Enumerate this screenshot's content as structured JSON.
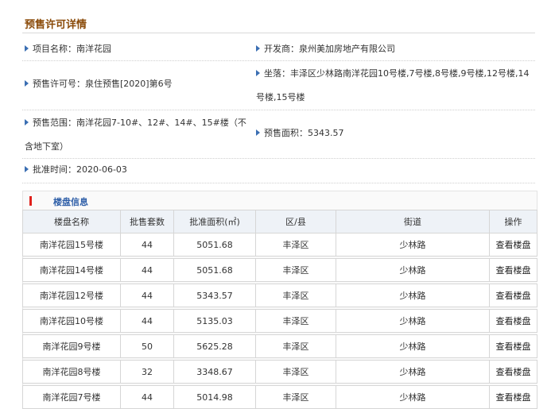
{
  "page_title": "预售许可详情",
  "details": {
    "project_name": "项目名称：南洋花园",
    "developer": "开发商：泉州美加房地产有限公司",
    "permit_no": "预售许可号：泉住预售[2020]第6号",
    "location": "坐落：丰泽区少林路南洋花园10号楼,7号楼,8号楼,9号楼,12号楼,14号楼,15号楼",
    "scope": "预售范围：南洋花园7-10#、12#、14#、15#楼（不含地下室）",
    "area": "预售面积：5343.57",
    "approval_time": "批准时间：2020-06-03"
  },
  "section_title": "楼盘信息",
  "table": {
    "headers": [
      "楼盘名称",
      "批售套数",
      "批准面积(㎡)",
      "区/县",
      "街道",
      "操作"
    ],
    "rows": [
      {
        "name": "南洋花园15号楼",
        "units": "44",
        "area": "5051.68",
        "district": "丰泽区",
        "street": "少林路",
        "action": "查看楼盘"
      },
      {
        "name": "南洋花园14号楼",
        "units": "44",
        "area": "5051.68",
        "district": "丰泽区",
        "street": "少林路",
        "action": "查看楼盘"
      },
      {
        "name": "南洋花园12号楼",
        "units": "44",
        "area": "5343.57",
        "district": "丰泽区",
        "street": "少林路",
        "action": "查看楼盘"
      },
      {
        "name": "南洋花园10号楼",
        "units": "44",
        "area": "5135.03",
        "district": "丰泽区",
        "street": "少林路",
        "action": "查看楼盘"
      },
      {
        "name": "南洋花园9号楼",
        "units": "50",
        "area": "5625.28",
        "district": "丰泽区",
        "street": "少林路",
        "action": "查看楼盘"
      },
      {
        "name": "南洋花园8号楼",
        "units": "32",
        "area": "3348.67",
        "district": "丰泽区",
        "street": "少林路",
        "action": "查看楼盘"
      },
      {
        "name": "南洋花园7号楼",
        "units": "44",
        "area": "5014.98",
        "district": "丰泽区",
        "street": "少林路",
        "action": "查看楼盘"
      }
    ]
  }
}
